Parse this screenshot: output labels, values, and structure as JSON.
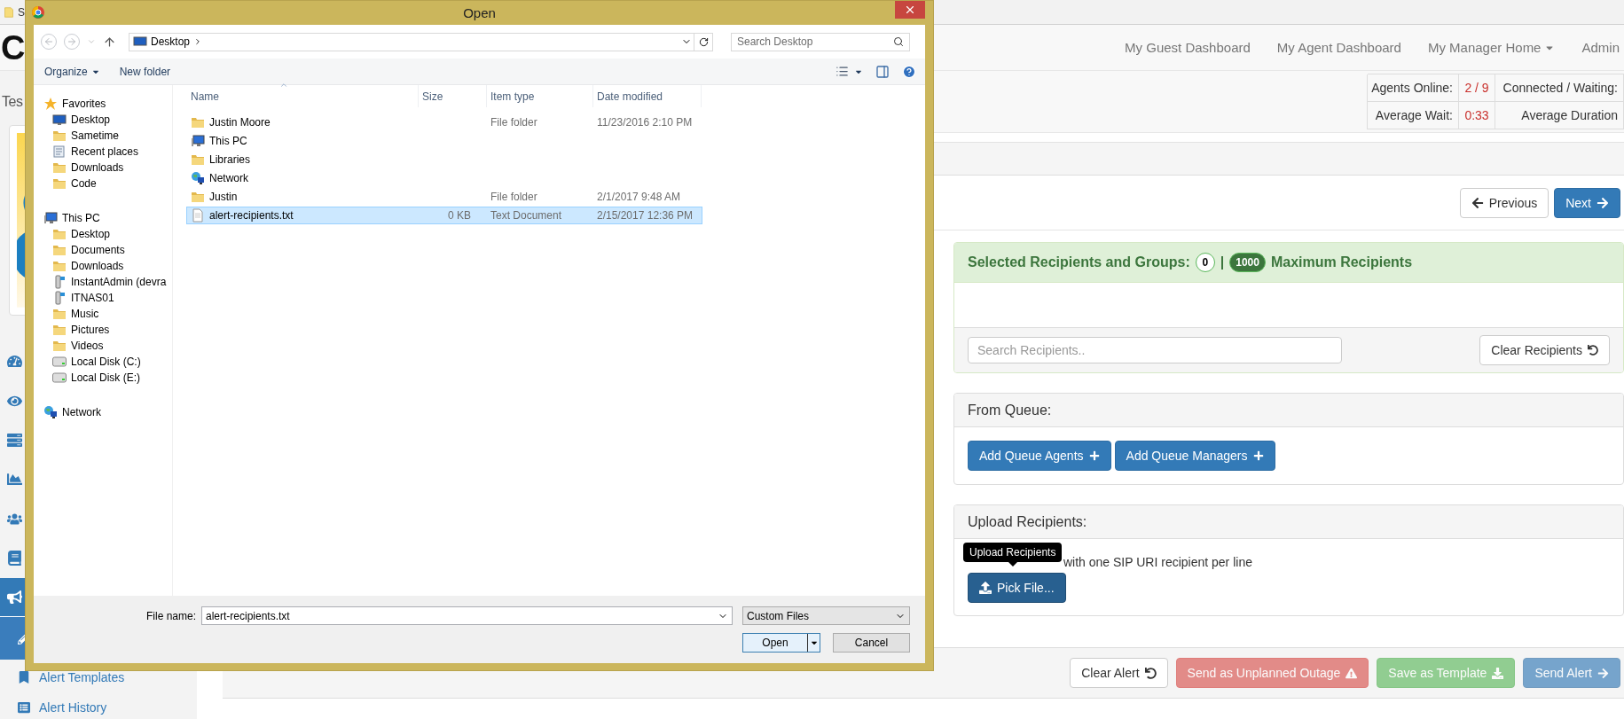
{
  "browser_tab": {
    "title": "S"
  },
  "navbar": {
    "logo": "C",
    "links": [
      {
        "label": "My Guest Dashboard",
        "dropdown": false
      },
      {
        "label": "My Agent Dashboard",
        "dropdown": false
      },
      {
        "label": "My Manager Home",
        "dropdown": true
      },
      {
        "label": "Admin",
        "dropdown": false
      }
    ]
  },
  "sidebar": {
    "heading": "Tes",
    "nav_items": [
      {
        "selected": false
      },
      {
        "selected": false
      },
      {
        "selected": false
      },
      {
        "selected": false
      },
      {
        "selected": false
      },
      {
        "selected": false
      },
      {
        "selected": true
      }
    ],
    "sub_items": [
      {
        "selected": true
      },
      {
        "label": "Alert Templates",
        "selected": false
      },
      {
        "label": "Alert History",
        "selected": false
      }
    ]
  },
  "stats": {
    "rows": [
      [
        {
          "text": "Agents Online:",
          "kind": "label"
        },
        {
          "text": "2 / 9",
          "kind": "value"
        },
        {
          "text": "Connected / Waiting:",
          "kind": "label"
        }
      ],
      [
        {
          "text": "Average Wait:",
          "kind": "label"
        },
        {
          "text": "0:33",
          "kind": "value"
        },
        {
          "text": "Average Duration",
          "kind": "label"
        }
      ]
    ]
  },
  "pager": {
    "previous": "Previous",
    "next": "Next"
  },
  "recipients_card": {
    "title": "Selected Recipients and Groups:",
    "selected_count": "0",
    "separator": "|",
    "max_count": "1000",
    "max_label": "Maximum Recipients",
    "search": {
      "placeholder": "Search Recipients.."
    },
    "clear_button": "Clear Recipients"
  },
  "queue_card": {
    "title": "From Queue:",
    "buttons": [
      "Add Queue Agents",
      "Add Queue Managers"
    ]
  },
  "upload_card": {
    "title": "Upload Recipients:",
    "hint": "with one SIP URI recipient per line",
    "tooltip": "Upload Recipients",
    "button": "Pick File..."
  },
  "actions": [
    {
      "label": "Clear Alert",
      "kind": "default",
      "disabled": false
    },
    {
      "label": "Send as Unplanned Outage",
      "kind": "danger",
      "disabled": true
    },
    {
      "label": "Save as Template",
      "kind": "success",
      "disabled": true
    },
    {
      "label": "Send Alert",
      "kind": "primary",
      "disabled": true
    }
  ],
  "dialog": {
    "title": "Open",
    "address": {
      "crumbs": [
        "Desktop"
      ],
      "search_placeholder": "Search Desktop"
    },
    "toolbar": {
      "organize": "Organize",
      "new_folder": "New folder"
    },
    "tree": [
      {
        "label": "Favorites",
        "kind": "star",
        "children": [
          {
            "label": "Desktop",
            "kind": "desktop"
          },
          {
            "label": "Sametime",
            "kind": "folder"
          },
          {
            "label": "Recent places",
            "kind": "recent"
          },
          {
            "label": "Downloads",
            "kind": "folder"
          },
          {
            "label": "Code",
            "kind": "folder"
          }
        ]
      },
      {
        "label": "This PC",
        "kind": "computer",
        "children": [
          {
            "label": "Desktop",
            "kind": "folder"
          },
          {
            "label": "Documents",
            "kind": "folder"
          },
          {
            "label": "Downloads",
            "kind": "folder"
          },
          {
            "label": "InstantAdmin (devra",
            "kind": "network-drive"
          },
          {
            "label": "ITNAS01",
            "kind": "network-drive"
          },
          {
            "label": "Music",
            "kind": "folder"
          },
          {
            "label": "Pictures",
            "kind": "folder"
          },
          {
            "label": "Videos",
            "kind": "folder"
          },
          {
            "label": "Local Disk (C:)",
            "kind": "drive"
          },
          {
            "label": "Local Disk (E:)",
            "kind": "drive"
          }
        ]
      },
      {
        "label": "Network",
        "kind": "network"
      }
    ],
    "columns": [
      {
        "label": "Name",
        "sorted": true
      },
      {
        "label": "Size",
        "sorted": false
      },
      {
        "label": "Item type",
        "sorted": false
      },
      {
        "label": "Date modified",
        "sorted": false
      }
    ],
    "files": [
      {
        "name": "Justin Moore",
        "kind": "folder",
        "type": "File folder",
        "date": "11/23/2016 2:10 PM",
        "selected": false
      },
      {
        "name": "This PC",
        "kind": "computer",
        "selected": false
      },
      {
        "name": "Libraries",
        "kind": "folder",
        "selected": false
      },
      {
        "name": "Network",
        "kind": "network",
        "selected": false
      },
      {
        "name": "Justin",
        "kind": "folder",
        "type": "File folder",
        "date": "2/1/2017 9:48 AM",
        "selected": false
      },
      {
        "name": "alert-recipients.txt",
        "kind": "text-file",
        "size": "0 KB",
        "type": "Text Document",
        "date": "2/15/2017 12:36 PM",
        "selected": true
      }
    ],
    "file_name": {
      "label": "File name:",
      "value": "alert-recipients.txt"
    },
    "file_type": "Custom Files",
    "open_button": "Open",
    "cancel_button": "Cancel"
  }
}
